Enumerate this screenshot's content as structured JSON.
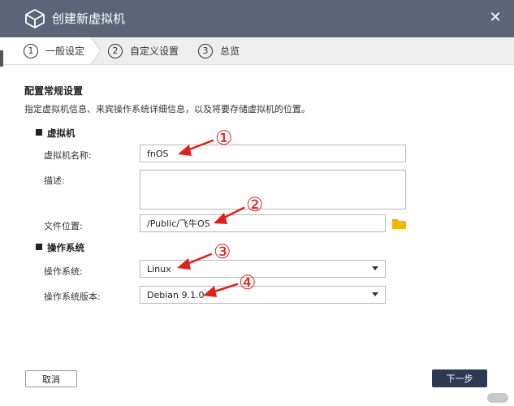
{
  "window": {
    "title": "创建新虚拟机",
    "close_symbol": "✕",
    "logo_icon": "vm-cube-icon"
  },
  "steps": [
    {
      "num": "1",
      "label": "一般设定",
      "active": true
    },
    {
      "num": "2",
      "label": "自定义设置",
      "active": false
    },
    {
      "num": "3",
      "label": "总览",
      "active": false
    }
  ],
  "section": {
    "title": "配置常规设置",
    "description": "指定虚拟机信息、来宾操作系统详细信息，以及将要存储虚拟机的位置。"
  },
  "vm_group": {
    "title": "虚拟机",
    "name_label": "虚拟机名称:",
    "name_value": "fnOS",
    "desc_label": "描述:",
    "desc_value": "",
    "location_label": "文件位置:",
    "location_value": "/Public/飞牛OS",
    "folder_icon": "folder-icon"
  },
  "os_group": {
    "title": "操作系统",
    "os_label": "操作系统:",
    "os_value": "Linux",
    "version_label": "操作系统版本:",
    "version_value": "Debian 9.1.0"
  },
  "annotations": [
    "①",
    "②",
    "③",
    "④"
  ],
  "annotation_color": "#e0211b",
  "footer": {
    "cancel": "取消",
    "next": "下一步"
  },
  "colors": {
    "titlebar": "#5c6577",
    "primary_button": "#2d3a53",
    "folder": "#f5b800"
  }
}
